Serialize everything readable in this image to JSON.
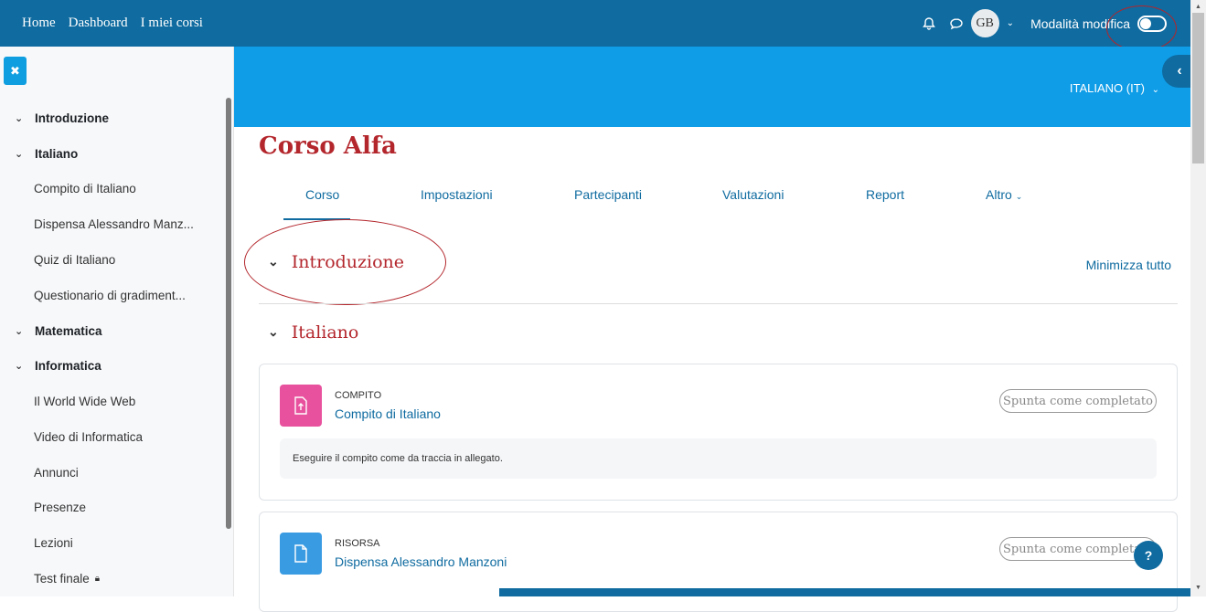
{
  "navbar": {
    "links": [
      "Home",
      "Dashboard",
      "I miei corsi"
    ],
    "avatar_initials": "GB",
    "edit_mode_label": "Modalità modifica",
    "edit_mode_on": false
  },
  "language": "ITALIANO (IT)",
  "sidebar": {
    "items": [
      {
        "label": "Introduzione",
        "type": "section"
      },
      {
        "label": "Italiano",
        "type": "section"
      },
      {
        "label": "Compito di Italiano",
        "type": "activity"
      },
      {
        "label": "Dispensa Alessandro Manz...",
        "type": "activity"
      },
      {
        "label": "Quiz di Italiano",
        "type": "activity"
      },
      {
        "label": "Questionario di gradiment...",
        "type": "activity"
      },
      {
        "label": "Matematica",
        "type": "section"
      },
      {
        "label": "Informatica",
        "type": "section"
      },
      {
        "label": "Il World Wide Web",
        "type": "activity"
      },
      {
        "label": "Video di Informatica",
        "type": "activity"
      },
      {
        "label": "Annunci",
        "type": "activity"
      },
      {
        "label": "Presenze",
        "type": "activity"
      },
      {
        "label": "Lezioni",
        "type": "activity"
      },
      {
        "label": "Test finale",
        "type": "activity",
        "locked": true
      }
    ]
  },
  "course": {
    "title": "Corso Alfa",
    "tabs": [
      "Corso",
      "Impostazioni",
      "Partecipanti",
      "Valutazioni",
      "Report",
      "Altro"
    ],
    "active_tab": "Corso",
    "collapse_all": "Minimizza tutto",
    "sections": [
      "Introduzione",
      "Italiano"
    ]
  },
  "activities": [
    {
      "type": "COMPITO",
      "name": "Compito di Italiano",
      "complete_label": "Spunta come completato",
      "description": "Eseguire il compito come da traccia in allegato.",
      "icon": "assignment-icon",
      "color": "#e8519d"
    },
    {
      "type": "RISORSA",
      "name": "Dispensa Alessandro Manzoni",
      "complete_label": "Spunta come completato",
      "icon": "file-icon",
      "color": "#399be2"
    }
  ],
  "colors": {
    "primary": "#0f6ba0",
    "banner": "#0f9de8",
    "accent_red": "#b3262c"
  },
  "help_label": "?"
}
